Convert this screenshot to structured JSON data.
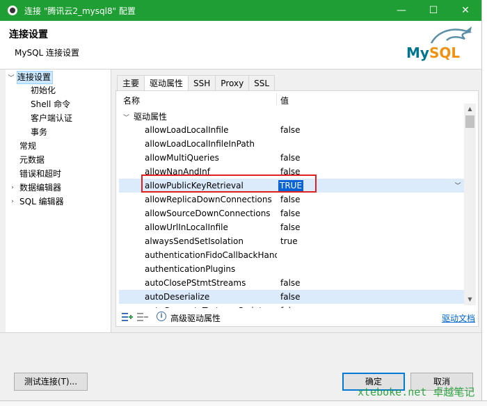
{
  "window": {
    "title": "连接 \"腾讯云2_mysql8\" 配置",
    "minimize": "—",
    "maximize": "☐",
    "close": "✕"
  },
  "header": {
    "title": "连接设置",
    "subtitle": "MySQL 连接设置",
    "logo_my": "My",
    "logo_sql": "SQL"
  },
  "nav": {
    "items": [
      {
        "label": "连接设置"
      },
      {
        "label": "初始化"
      },
      {
        "label": "Shell 命令"
      },
      {
        "label": "客户端认证"
      },
      {
        "label": "事务"
      },
      {
        "label": "常规"
      },
      {
        "label": "元数据"
      },
      {
        "label": "错误和超时"
      },
      {
        "label": "数据编辑器"
      },
      {
        "label": "SQL 编辑器"
      }
    ]
  },
  "tabs": [
    {
      "label": "主要"
    },
    {
      "label": "驱动属性"
    },
    {
      "label": "SSH"
    },
    {
      "label": "Proxy"
    },
    {
      "label": "SSL"
    }
  ],
  "props": {
    "col_name": "名称",
    "col_value": "值",
    "group": "驱动属性",
    "rows": [
      {
        "name": "allowLoadLocalInfile",
        "value": "false"
      },
      {
        "name": "allowLoadLocalInfileInPath",
        "value": ""
      },
      {
        "name": "allowMultiQueries",
        "value": "false"
      },
      {
        "name": "allowNanAndInf",
        "value": "false"
      },
      {
        "name": "allowPublicKeyRetrieval",
        "value": "TRUE"
      },
      {
        "name": "allowReplicaDownConnections",
        "value": "false"
      },
      {
        "name": "allowSourceDownConnections",
        "value": "false"
      },
      {
        "name": "allowUrlInLocalInfile",
        "value": "false"
      },
      {
        "name": "alwaysSendSetIsolation",
        "value": "true"
      },
      {
        "name": "authenticationFidoCallbackHandler",
        "value": ""
      },
      {
        "name": "authenticationPlugins",
        "value": ""
      },
      {
        "name": "autoClosePStmtStreams",
        "value": "false"
      },
      {
        "name": "autoDeserialize",
        "value": "false"
      },
      {
        "name": "autoGenerateTestcaseScript",
        "value": "false"
      }
    ],
    "advanced_label": "高级驱动属性",
    "doc_link": "驱动文档"
  },
  "footer": {
    "test_button": "测试连接(T)...",
    "ok_button": "确定",
    "cancel_button": "取消",
    "watermark": "xteboke.net 卓越笔记"
  }
}
